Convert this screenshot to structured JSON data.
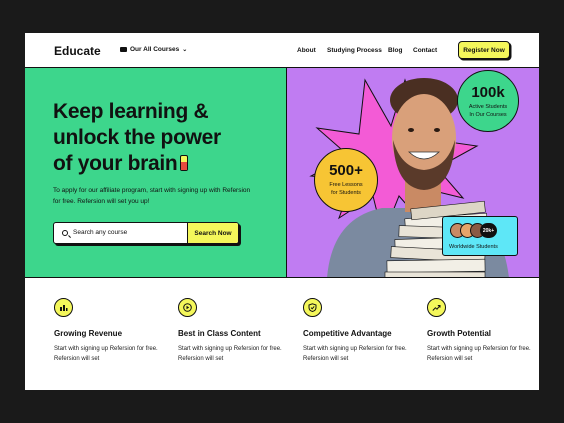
{
  "nav": {
    "logo": "Educate",
    "courses_label": "Our All Courses",
    "links": [
      "About",
      "Studying Process",
      "Blog",
      "Contact"
    ],
    "register_label": "Register Now"
  },
  "hero": {
    "headline_1": "Keep learning &",
    "headline_2": "unlock the power",
    "headline_3": "of your brain",
    "subtext": "To apply for our affiliate program, start with signing up with Refersion for free. Refersion will set you up!",
    "search_placeholder": "Search any course",
    "search_button": "Search Now"
  },
  "stats": {
    "students_value": "100k",
    "students_label_1": "Active Students",
    "students_label_2": "In Our Courses",
    "lessons_value": "500+",
    "lessons_label_1": "Free Lessons",
    "lessons_label_2": "for Students",
    "world_count": "20k+",
    "world_label": "Worldwide Students"
  },
  "features": [
    {
      "icon": "growth-chart-icon",
      "title": "Growing Revenue",
      "desc": "Start with signing up Refersion for free. Refersion will set"
    },
    {
      "icon": "play-icon",
      "title": "Best in Class Content",
      "desc": "Start with signing up Refersion for free. Refersion will set"
    },
    {
      "icon": "shield-icon",
      "title": "Competitive Advantage",
      "desc": "Start with signing up Refersion for free. Refersion will set"
    },
    {
      "icon": "trend-up-icon",
      "title": "Growth Potential",
      "desc": "Start with signing up Refersion for free. Refersion will set"
    }
  ],
  "colors": {
    "green": "#3dd68c",
    "purple": "#c07cf2",
    "yellow": "#f4f75b",
    "orange": "#f7c534",
    "cyan": "#5ee7f7",
    "pink": "#f35bd6"
  }
}
